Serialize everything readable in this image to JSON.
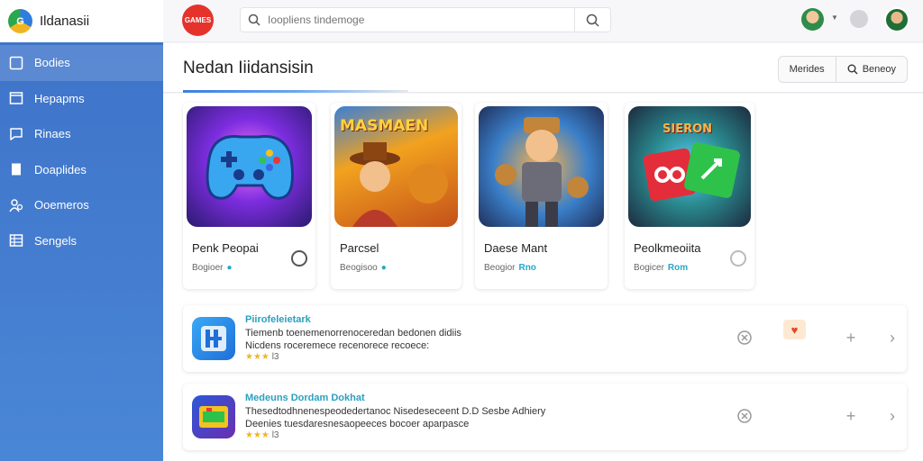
{
  "app": {
    "name": "Ildanasii"
  },
  "sidebar": {
    "items": [
      {
        "label": "Bodies",
        "icon": "square-icon"
      },
      {
        "label": "Hepapms",
        "icon": "window-icon"
      },
      {
        "label": "Rinaes",
        "icon": "chat-icon"
      },
      {
        "label": "Doaplides",
        "icon": "document-icon"
      },
      {
        "label": "Ooemeros",
        "icon": "people-icon"
      },
      {
        "label": "Sengels",
        "icon": "table-icon"
      }
    ]
  },
  "header": {
    "logo_text": "GAMES",
    "search": {
      "placeholder": "Ioopliens tindemoge",
      "value": ""
    }
  },
  "main": {
    "title": "Nedan Iiidansisin",
    "buttons": [
      {
        "label": "Merides"
      },
      {
        "label": "Beneoy",
        "icon": "search-icon"
      }
    ]
  },
  "cards": [
    {
      "title": "Penk Peopai",
      "sub": "Bogioer",
      "tag": "●",
      "art_text": ""
    },
    {
      "title": "Parcsel",
      "sub": "Beogisoo",
      "tag": "●",
      "art_text": "MASMAEN"
    },
    {
      "title": "Daese Mant",
      "sub": "Beogior",
      "tag": "Rno",
      "art_text": ""
    },
    {
      "title": "Peolkmeoiita",
      "sub": "Bogicer",
      "tag": "Rom",
      "art_text": "SIERON"
    }
  ],
  "rows": [
    {
      "title": "Piirofeleietark",
      "desc_line1": "Tiemenb toenemenorrenoceredan bedonen didiis",
      "desc_line2": "Nicdens roceremece recenorece recoece:",
      "rating": "★★★",
      "rating_count": "l3"
    },
    {
      "title": "Medeuns Dordam Dokhat",
      "desc_line1": "Thesedtodhnenespeodedertanoc Nisedeseceent D.D Sesbe Adhiery",
      "desc_line2": "Deenies tuesdaresnesaopeeces bocoer aparpasce",
      "rating": "★★★",
      "rating_count": "l3"
    }
  ],
  "colors": {
    "sidebar": "#4a86d6",
    "accent": "#26a7c9",
    "logo_red": "#e5322b"
  }
}
